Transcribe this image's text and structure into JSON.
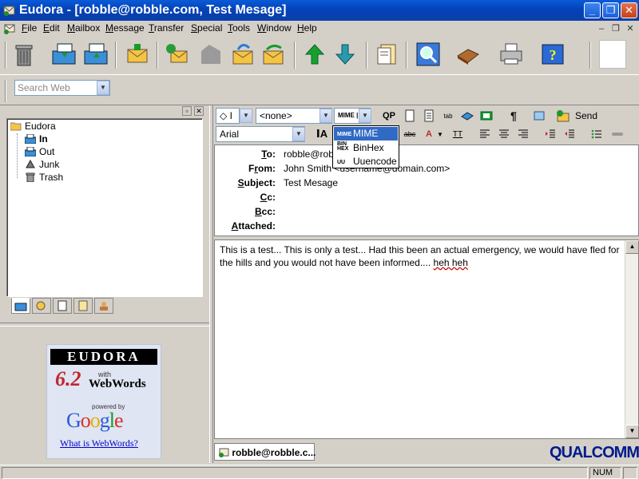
{
  "window": {
    "title": "Eudora - [robble@robble.com, Test Mesage]",
    "controls": [
      "_",
      "❐",
      "✕"
    ]
  },
  "menubar": {
    "items": [
      {
        "label": "File",
        "key": "F",
        "rest": "ile"
      },
      {
        "label": "Edit",
        "key": "E",
        "rest": "dit"
      },
      {
        "label": "Mailbox",
        "key": "M",
        "rest": "ailbox"
      },
      {
        "label": "Message",
        "key": "M",
        "rest": "essage"
      },
      {
        "label": "Transfer",
        "key": "T",
        "rest": "ransfer"
      },
      {
        "label": "Special",
        "key": "S",
        "rest": "pecial"
      },
      {
        "label": "Tools",
        "key": "T",
        "rest": "ools"
      },
      {
        "label": "Window",
        "key": "W",
        "rest": "indow"
      },
      {
        "label": "Help",
        "key": "H",
        "rest": "elp"
      }
    ]
  },
  "search": {
    "placeholder": "Search Web"
  },
  "mailboxes": {
    "root": "Eudora",
    "items": [
      "In",
      "Out",
      "Junk",
      "Trash"
    ]
  },
  "ad": {
    "brand": "EUDORA",
    "version": "6.2",
    "with": "with",
    "product": "WebWords",
    "powered_by": "powered by",
    "google": "Google",
    "link": "What is WebWords?"
  },
  "compose_toolbar": {
    "priority_value": "◇ I",
    "signature_value": "<none>",
    "encoding_value": "MIME",
    "qp_label": "QP",
    "send_label": "Send",
    "font_value": "Arial"
  },
  "encoding_options": [
    {
      "tag": "MIME",
      "label": "MIME",
      "selected": true
    },
    {
      "tag": "BIN HEX",
      "label": "BinHex",
      "selected": false
    },
    {
      "tag": "UU",
      "label": "Uuencode",
      "selected": false
    }
  ],
  "headers": {
    "to_label": "To:",
    "to_value": "robble@robble.com",
    "from_label": "From:",
    "from_value": "John Smith <username@domain.com>",
    "subject_label": "Subject:",
    "subject_value": "Test Mesage",
    "cc_label": "Cc:",
    "bcc_label": "Bcc:",
    "attached_label": "Attached:"
  },
  "body": {
    "text": "This is a test... This is only a test... Had this been an actual emergency, we would have fled for the hills and you would not have been informed.... ",
    "misspelled": "heh heh"
  },
  "window_tab": {
    "label": "robble@robble.c..."
  },
  "brand_footer": "QUALCOMM",
  "status": {
    "num": "NUM"
  },
  "colors": {
    "titlebar": "#0a5bd8",
    "selection": "#316ac5",
    "qualcomm": "#001a8c"
  }
}
